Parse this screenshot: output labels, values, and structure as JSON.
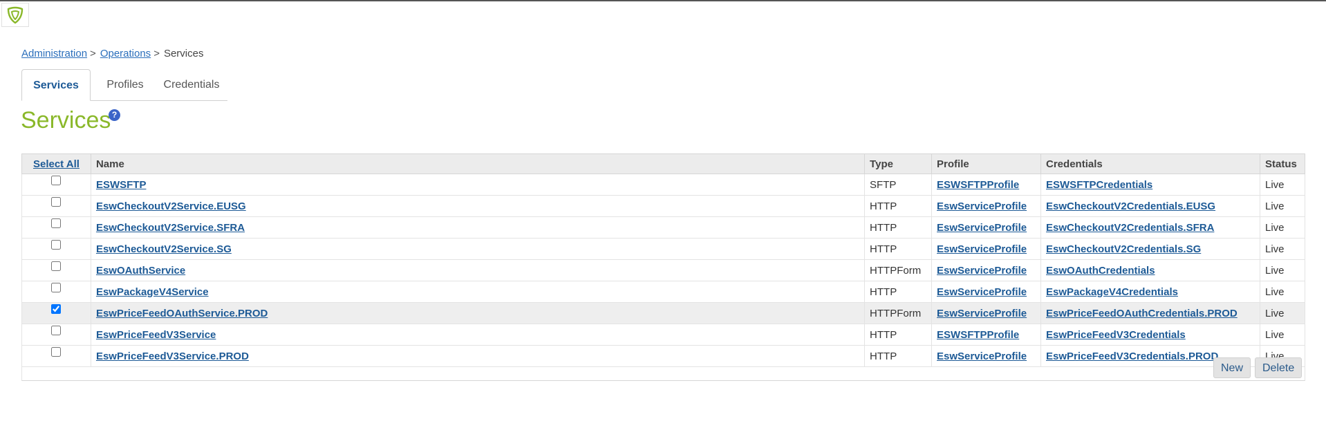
{
  "breadcrumb": {
    "items": [
      "Administration",
      "Operations"
    ],
    "separator": ">",
    "current": "Services"
  },
  "tabs": [
    {
      "label": "Services",
      "active": true
    },
    {
      "label": "Profiles",
      "active": false
    },
    {
      "label": "Credentials",
      "active": false
    }
  ],
  "page": {
    "title": "Services",
    "help_glyph": "?"
  },
  "colors": {
    "title": "#8ab82a",
    "link": "#1d5a96",
    "help": "#3b64c8"
  },
  "table": {
    "headers": {
      "select_all": "Select All",
      "name": "Name",
      "type": "Type",
      "profile": "Profile",
      "credentials": "Credentials",
      "status": "Status"
    },
    "rows": [
      {
        "checked": false,
        "name": "ESWSFTP",
        "type": "SFTP",
        "profile": "ESWSFTPProfile",
        "credentials": "ESWSFTPCredentials",
        "status": "Live"
      },
      {
        "checked": false,
        "name": "EswCheckoutV2Service.EUSG",
        "type": "HTTP",
        "profile": "EswServiceProfile",
        "credentials": "EswCheckoutV2Credentials.EUSG",
        "status": "Live"
      },
      {
        "checked": false,
        "name": "EswCheckoutV2Service.SFRA",
        "type": "HTTP",
        "profile": "EswServiceProfile",
        "credentials": "EswCheckoutV2Credentials.SFRA",
        "status": "Live"
      },
      {
        "checked": false,
        "name": "EswCheckoutV2Service.SG",
        "type": "HTTP",
        "profile": "EswServiceProfile",
        "credentials": "EswCheckoutV2Credentials.SG",
        "status": "Live"
      },
      {
        "checked": false,
        "name": "EswOAuthService",
        "type": "HTTPForm",
        "profile": "EswServiceProfile",
        "credentials": "EswOAuthCredentials",
        "status": "Live"
      },
      {
        "checked": false,
        "name": "EswPackageV4Service",
        "type": "HTTP",
        "profile": "EswServiceProfile",
        "credentials": "EswPackageV4Credentials",
        "status": "Live"
      },
      {
        "checked": true,
        "name": "EswPriceFeedOAuthService.PROD",
        "type": "HTTPForm",
        "profile": "EswServiceProfile",
        "credentials": "EswPriceFeedOAuthCredentials.PROD",
        "status": "Live"
      },
      {
        "checked": false,
        "name": "EswPriceFeedV3Service",
        "type": "HTTP",
        "profile": "ESWSFTPProfile",
        "credentials": "EswPriceFeedV3Credentials",
        "status": "Live"
      },
      {
        "checked": false,
        "name": "EswPriceFeedV3Service.PROD",
        "type": "HTTP",
        "profile": "EswServiceProfile",
        "credentials": "EswPriceFeedV3Credentials.PROD",
        "status": "Live"
      }
    ]
  },
  "actions": {
    "new_label": "New",
    "delete_label": "Delete"
  }
}
